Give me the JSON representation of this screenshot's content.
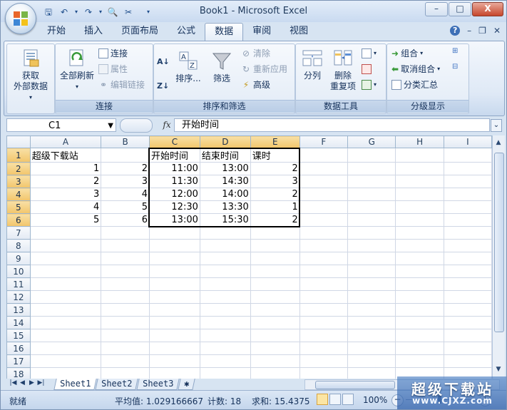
{
  "window": {
    "title": "Book1 - Microsoft Excel",
    "controls": {
      "minimize": "–",
      "maximize": "□",
      "close": "X"
    }
  },
  "quick_access": [
    "save-icon",
    "undo-icon",
    "redo-icon",
    "print-preview-icon",
    "tools-icon",
    "customize-icon"
  ],
  "tabs": [
    {
      "label": "开始"
    },
    {
      "label": "插入"
    },
    {
      "label": "页面布局"
    },
    {
      "label": "公式"
    },
    {
      "label": "数据",
      "active": true
    },
    {
      "label": "审阅"
    },
    {
      "label": "视图"
    }
  ],
  "ribbon": {
    "get_external": {
      "line1": "获取",
      "line2": "外部数据"
    },
    "connections": {
      "refresh_line1": "全部刷新",
      "connect": "连接",
      "properties": "属性",
      "edit_links": "编辑链接",
      "label": "连接"
    },
    "sort_filter": {
      "sort": "排序...",
      "filter": "筛选",
      "clear": "清除",
      "reapply": "重新应用",
      "advanced": "高级",
      "label": "排序和筛选"
    },
    "data_tools": {
      "text_to_columns": "分列",
      "remove_dup_line1": "删除",
      "remove_dup_line2": "重复项",
      "label": "数据工具"
    },
    "outline": {
      "group": "组合",
      "ungroup": "取消组合",
      "subtotal": "分类汇总",
      "label": "分级显示"
    }
  },
  "formula_bar": {
    "name_box": "C1",
    "fx": "fx",
    "content": "开始时间"
  },
  "grid": {
    "columns": [
      "A",
      "B",
      "C",
      "D",
      "E",
      "F",
      "G",
      "H",
      "I"
    ],
    "selected_columns": [
      "C",
      "D",
      "E"
    ],
    "selected_rows": [
      "1",
      "2",
      "3",
      "4",
      "5",
      "6"
    ],
    "rows": [
      {
        "num": "1",
        "cells": [
          "超级下载站",
          "",
          "开始时间",
          "结束时间",
          "课时",
          "",
          "",
          "",
          ""
        ]
      },
      {
        "num": "2",
        "cells": [
          "1",
          "2",
          "11:00",
          "13:00",
          "2",
          "",
          "",
          "",
          ""
        ]
      },
      {
        "num": "3",
        "cells": [
          "2",
          "3",
          "11:30",
          "14:30",
          "3",
          "",
          "",
          "",
          ""
        ]
      },
      {
        "num": "4",
        "cells": [
          "3",
          "4",
          "12:00",
          "14:00",
          "2",
          "",
          "",
          "",
          ""
        ]
      },
      {
        "num": "5",
        "cells": [
          "4",
          "5",
          "12:30",
          "13:30",
          "1",
          "",
          "",
          "",
          ""
        ]
      },
      {
        "num": "6",
        "cells": [
          "5",
          "6",
          "13:00",
          "15:30",
          "2",
          "",
          "",
          "",
          ""
        ]
      },
      {
        "num": "7",
        "cells": [
          "",
          "",
          "",
          "",
          "",
          "",
          "",
          "",
          ""
        ]
      },
      {
        "num": "8",
        "cells": [
          "",
          "",
          "",
          "",
          "",
          "",
          "",
          "",
          ""
        ]
      },
      {
        "num": "9",
        "cells": [
          "",
          "",
          "",
          "",
          "",
          "",
          "",
          "",
          ""
        ]
      },
      {
        "num": "10",
        "cells": [
          "",
          "",
          "",
          "",
          "",
          "",
          "",
          "",
          ""
        ]
      },
      {
        "num": "11",
        "cells": [
          "",
          "",
          "",
          "",
          "",
          "",
          "",
          "",
          ""
        ]
      },
      {
        "num": "12",
        "cells": [
          "",
          "",
          "",
          "",
          "",
          "",
          "",
          "",
          ""
        ]
      },
      {
        "num": "13",
        "cells": [
          "",
          "",
          "",
          "",
          "",
          "",
          "",
          "",
          ""
        ]
      },
      {
        "num": "14",
        "cells": [
          "",
          "",
          "",
          "",
          "",
          "",
          "",
          "",
          ""
        ]
      },
      {
        "num": "15",
        "cells": [
          "",
          "",
          "",
          "",
          "",
          "",
          "",
          "",
          ""
        ]
      },
      {
        "num": "16",
        "cells": [
          "",
          "",
          "",
          "",
          "",
          "",
          "",
          "",
          ""
        ]
      },
      {
        "num": "17",
        "cells": [
          "",
          "",
          "",
          "",
          "",
          "",
          "",
          "",
          ""
        ]
      },
      {
        "num": "18",
        "cells": [
          "",
          "",
          "",
          "",
          "",
          "",
          "",
          "",
          ""
        ]
      }
    ]
  },
  "sheets": [
    {
      "label": "Sheet1",
      "active": true
    },
    {
      "label": "Sheet2"
    },
    {
      "label": "Sheet3"
    }
  ],
  "status": {
    "ready": "就绪",
    "average": "平均值: 1.029166667",
    "count": "计数: 18",
    "sum": "求和: 15.4375",
    "zoom": "100%"
  },
  "watermark": {
    "line1": "超级下载站",
    "line2": "www.CJXZ.com"
  },
  "colors": {
    "selected_header": "#f2c56b",
    "ribbon_bg": "#dfe9f6",
    "grid_line": "#d0d7e5"
  }
}
